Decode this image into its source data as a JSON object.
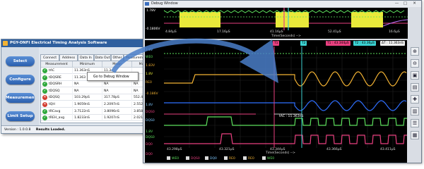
{
  "app": {
    "title": "PGY-ONFI Electrical Timing Analysis Software",
    "sidebar": [
      "Select",
      "Configure",
      "Measurement",
      "Limit Setup"
    ],
    "tabs": [
      "Connect",
      "Address",
      "Data In",
      "Data Out",
      "Other",
      "Measurements"
    ],
    "tab_overflow": "A",
    "columns": [
      "Measurement",
      "Minimum",
      "Mean",
      "Maximum"
    ],
    "rows": [
      {
        "status": "pass",
        "name": "tAC",
        "min": "11.363nS",
        "mean": "11.3",
        "max": ""
      },
      {
        "status": "pass",
        "name": "tDQSRE",
        "min": "11.363",
        "mean": "",
        "max": ""
      },
      {
        "status": "pass",
        "name": "tDQSRH",
        "min": "NA",
        "mean": "NA",
        "max": "NA"
      },
      {
        "status": "pass",
        "name": "tDQSQ",
        "min": "NA",
        "mean": "NA",
        "max": "NA"
      },
      {
        "status": "fail",
        "name": "tDQSQ",
        "min": "103.29pS",
        "mean": "317.78pS",
        "max": "552.49pS"
      },
      {
        "status": "fail",
        "name": "tQH",
        "min": "1.9059nS",
        "mean": "2.2097nS",
        "max": "2.5522nS"
      },
      {
        "status": "pass",
        "name": "tRCavg",
        "min": "3.7122nS",
        "mean": "3.8096nS",
        "max": "3.8583nS"
      },
      {
        "status": "pass",
        "name": "tREH_avg",
        "min": "1.8233nS",
        "mean": "1.9207nS",
        "max": "2.0210nS"
      }
    ],
    "context_menu": "Go to Debug Window",
    "status_version": "Version : 1.0.0.8",
    "status_text": "Results Loaded."
  },
  "debug": {
    "title": "Debug Window",
    "controls": [
      "—",
      "□",
      "✕"
    ],
    "overview": {
      "labels": [
        "1.78V",
        "-0.1806V"
      ],
      "ticks": [
        "4.84μS",
        "17.16μS",
        "41.16μS",
        "52.41μS",
        "16.6μS"
      ],
      "axis_title": "Time(Seconds) -->",
      "cursor_t1": "T1 : 43.344μS",
      "cursor_t2": "T2 : 43.36μS",
      "cursor_dt": "ΔT : 11.363nS"
    },
    "main": {
      "markers": [
        "T1",
        "T2"
      ],
      "ticks": [
        "43.298μS",
        "43.321μS",
        "43.344μS",
        "43.366μS",
        "43.411μS"
      ],
      "axis_title": "Time(Seconds) -->",
      "labels": [
        {
          "text": "1.8V",
          "color": "#7ec8ff"
        },
        {
          "text": "WE0",
          "color": "#5de05d"
        },
        {
          "text": "1.83V",
          "color": "#f2b233"
        },
        {
          "text": "1.8V",
          "color": "#e9e93a"
        },
        {
          "text": "RE0",
          "color": "#f2b233"
        },
        {
          "text": "-0.186V",
          "color": "#f2b233"
        },
        {
          "text": "1.8V",
          "color": "#7ec8ff"
        },
        {
          "text": "DQS0",
          "color": "#e94080"
        },
        {
          "text": "DQS0",
          "color": "#7ec8ff"
        },
        {
          "text": "1.8V",
          "color": "#5de05d"
        },
        {
          "text": "DQS0",
          "color": "#5de05d"
        },
        {
          "text": "DQ0",
          "color": "#e94080"
        },
        {
          "text": "DQ0",
          "color": "#e94080"
        }
      ],
      "annotation": "tAC : 11.363nS",
      "legend": [
        {
          "text": "WE0",
          "color": "#5de05d"
        },
        {
          "text": "DQS0",
          "color": "#e94080"
        },
        {
          "text": "DQ0",
          "color": "#7ec8ff"
        },
        {
          "text": "RE0",
          "color": "#f2b233"
        },
        {
          "text": "RE0",
          "color": "#f2b233"
        },
        {
          "text": "WE0",
          "color": "#5de05d"
        }
      ]
    },
    "toolbar_icons": [
      "zoom-in-icon",
      "zoom-out-icon",
      "fit-icon",
      "screenshot-icon",
      "cursor-icon",
      "marker-icon",
      "table-icon",
      "save-icon"
    ],
    "toolbar_glyphs": [
      "⊕",
      "⊖",
      "▣",
      "▤",
      "✚",
      "▥",
      "☰",
      "▦"
    ]
  },
  "colors": {
    "accent": "#2a5fae",
    "scope_bg": "#000000",
    "arrow": "#4a7ec8",
    "ch_yellow": "#f2b233",
    "ch_green": "#5de05d",
    "ch_magenta": "#e94080",
    "ch_blue": "#2f6fff",
    "ch_cyan": "#3bd1d1"
  }
}
